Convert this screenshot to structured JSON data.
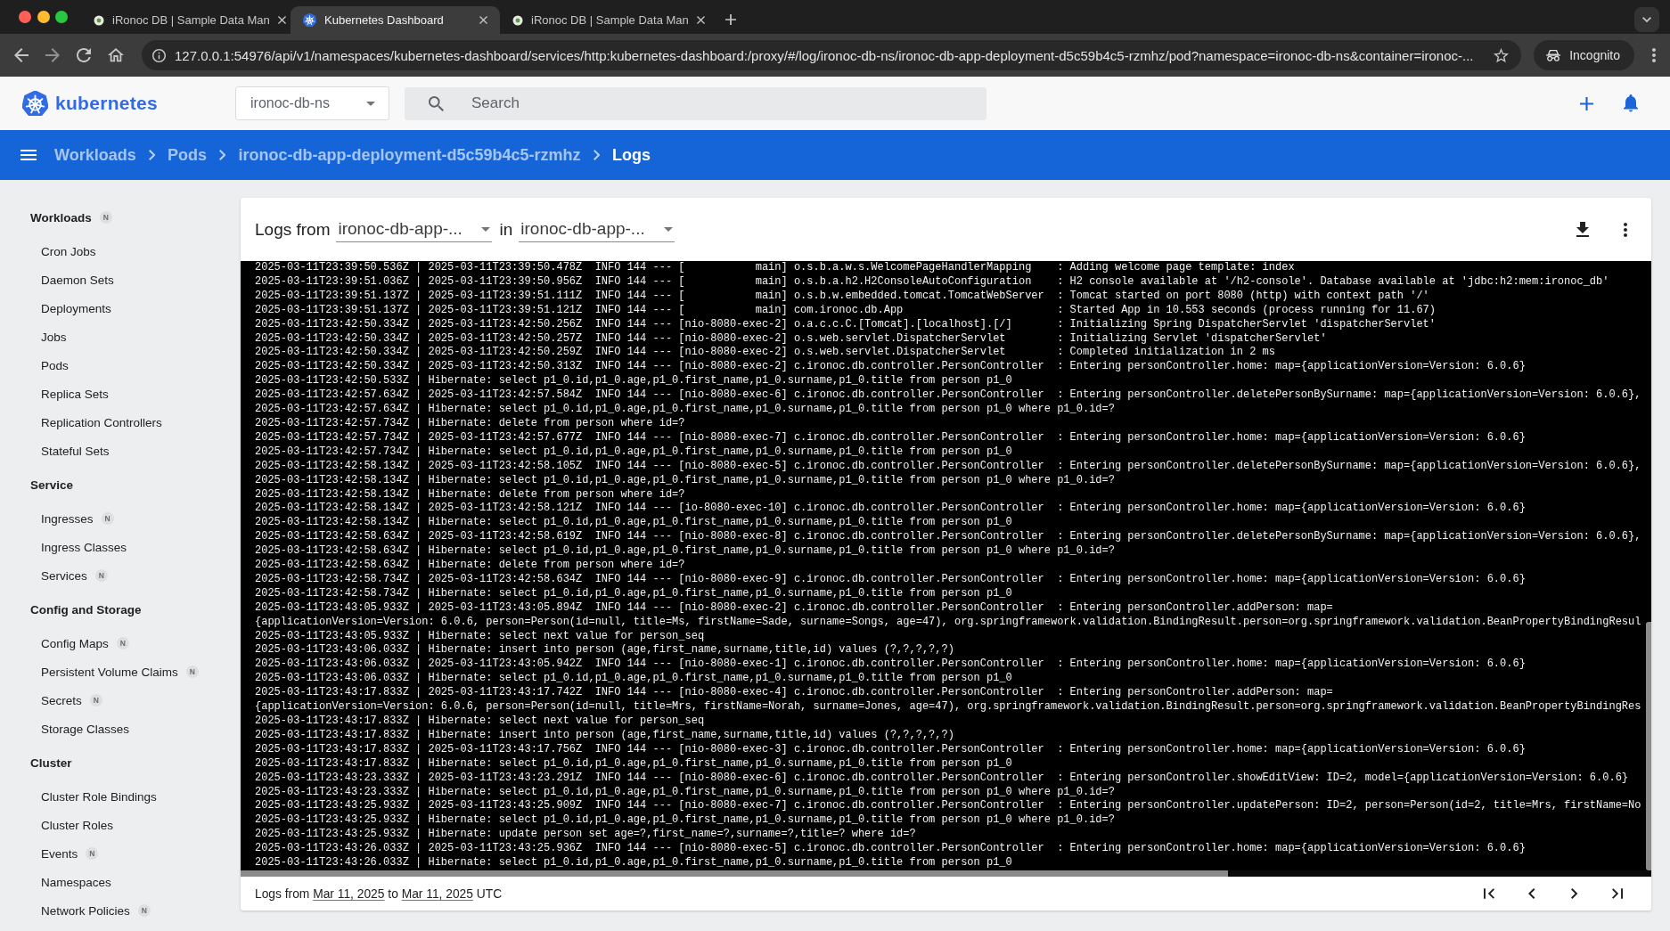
{
  "browser": {
    "tabs": [
      {
        "title": "iRonoc DB | Sample Data Man",
        "kind": "dot",
        "selected": false
      },
      {
        "title": "Kubernetes Dashboard",
        "kind": "wheel",
        "selected": true
      },
      {
        "title": "iRonoc DB | Sample Data Man",
        "kind": "dot",
        "selected": false
      }
    ],
    "url": "127.0.0.1:54976/api/v1/namespaces/kubernetes-dashboard/services/http:kubernetes-dashboard:/proxy/#/log/ironoc-db-ns/ironoc-db-app-deployment-d5c59b4c5-rzmhz/pod?namespace=ironoc-db-ns&container=ironoc-...",
    "profile": "Incognito"
  },
  "header": {
    "logo_text": "kubernetes",
    "namespace": "ironoc-db-ns",
    "search": {
      "placeholder": "Search"
    }
  },
  "breadcrumbs": [
    {
      "label": "Workloads",
      "current": false
    },
    {
      "label": "Pods",
      "current": false
    },
    {
      "label": "ironoc-db-app-deployment-d5c59b4c5-rzmhz",
      "current": false
    },
    {
      "label": "Logs",
      "current": true
    }
  ],
  "sidebar": {
    "sections": [
      {
        "title": "Workloads",
        "badge": "N",
        "items": [
          {
            "label": "Cron Jobs"
          },
          {
            "label": "Daemon Sets"
          },
          {
            "label": "Deployments"
          },
          {
            "label": "Jobs"
          },
          {
            "label": "Pods"
          },
          {
            "label": "Replica Sets"
          },
          {
            "label": "Replication Controllers"
          },
          {
            "label": "Stateful Sets"
          }
        ]
      },
      {
        "title": "Service",
        "items": [
          {
            "label": "Ingresses",
            "badge": "N"
          },
          {
            "label": "Ingress Classes"
          },
          {
            "label": "Services",
            "badge": "N"
          }
        ]
      },
      {
        "title": "Config and Storage",
        "items": [
          {
            "label": "Config Maps",
            "badge": "N"
          },
          {
            "label": "Persistent Volume Claims",
            "badge": "N"
          },
          {
            "label": "Secrets",
            "badge": "N"
          },
          {
            "label": "Storage Classes"
          }
        ]
      },
      {
        "title": "Cluster",
        "items": [
          {
            "label": "Cluster Role Bindings"
          },
          {
            "label": "Cluster Roles"
          },
          {
            "label": "Events",
            "badge": "N"
          },
          {
            "label": "Namespaces"
          },
          {
            "label": "Network Policies",
            "badge": "N"
          }
        ]
      }
    ]
  },
  "logs": {
    "title": "Logs from",
    "pod": "ironoc-db-app-...",
    "connector": "in",
    "container": "ironoc-db-app-...",
    "lines": [
      "2025-03-11T23:39:50.536Z | 2025-03-11T23:39:50.478Z  INFO 144 --- [           main] o.s.b.a.w.s.WelcomePageHandlerMapping    : Adding welcome page template: index",
      "2025-03-11T23:39:51.036Z | 2025-03-11T23:39:50.956Z  INFO 144 --- [           main] o.s.b.a.h2.H2ConsoleAutoConfiguration    : H2 console available at '/h2-console'. Database available at 'jdbc:h2:mem:ironoc_db'",
      "2025-03-11T23:39:51.137Z | 2025-03-11T23:39:51.111Z  INFO 144 --- [           main] o.s.b.w.embedded.tomcat.TomcatWebServer  : Tomcat started on port 8080 (http) with context path '/'",
      "2025-03-11T23:39:51.137Z | 2025-03-11T23:39:51.121Z  INFO 144 --- [           main] com.ironoc.db.App                        : Started App in 10.553 seconds (process running for 11.67)",
      "2025-03-11T23:42:50.334Z | 2025-03-11T23:42:50.256Z  INFO 144 --- [nio-8080-exec-2] o.a.c.c.C.[Tomcat].[localhost].[/]       : Initializing Spring DispatcherServlet 'dispatcherServlet'",
      "2025-03-11T23:42:50.334Z | 2025-03-11T23:42:50.257Z  INFO 144 --- [nio-8080-exec-2] o.s.web.servlet.DispatcherServlet        : Initializing Servlet 'dispatcherServlet'",
      "2025-03-11T23:42:50.334Z | 2025-03-11T23:42:50.259Z  INFO 144 --- [nio-8080-exec-2] o.s.web.servlet.DispatcherServlet        : Completed initialization in 2 ms",
      "2025-03-11T23:42:50.334Z | 2025-03-11T23:42:50.313Z  INFO 144 --- [nio-8080-exec-2] c.ironoc.db.controller.PersonController  : Entering personController.home: map={applicationVersion=Version: 6.0.6}",
      "2025-03-11T23:42:50.533Z | Hibernate: select p1_0.id,p1_0.age,p1_0.first_name,p1_0.surname,p1_0.title from person p1_0",
      "2025-03-11T23:42:57.634Z | 2025-03-11T23:42:57.584Z  INFO 144 --- [nio-8080-exec-6] c.ironoc.db.controller.PersonController  : Entering personController.deletePersonBySurname: map={applicationVersion=Version: 6.0.6},",
      "2025-03-11T23:42:57.634Z | Hibernate: select p1_0.id,p1_0.age,p1_0.first_name,p1_0.surname,p1_0.title from person p1_0 where p1_0.id=?",
      "2025-03-11T23:42:57.734Z | Hibernate: delete from person where id=?",
      "2025-03-11T23:42:57.734Z | 2025-03-11T23:42:57.677Z  INFO 144 --- [nio-8080-exec-7] c.ironoc.db.controller.PersonController  : Entering personController.home: map={applicationVersion=Version: 6.0.6}",
      "2025-03-11T23:42:57.734Z | Hibernate: select p1_0.id,p1_0.age,p1_0.first_name,p1_0.surname,p1_0.title from person p1_0",
      "2025-03-11T23:42:58.134Z | 2025-03-11T23:42:58.105Z  INFO 144 --- [nio-8080-exec-5] c.ironoc.db.controller.PersonController  : Entering personController.deletePersonBySurname: map={applicationVersion=Version: 6.0.6},",
      "2025-03-11T23:42:58.134Z | Hibernate: select p1_0.id,p1_0.age,p1_0.first_name,p1_0.surname,p1_0.title from person p1_0 where p1_0.id=?",
      "2025-03-11T23:42:58.134Z | Hibernate: delete from person where id=?",
      "2025-03-11T23:42:58.134Z | 2025-03-11T23:42:58.121Z  INFO 144 --- [io-8080-exec-10] c.ironoc.db.controller.PersonController  : Entering personController.home: map={applicationVersion=Version: 6.0.6}",
      "2025-03-11T23:42:58.134Z | Hibernate: select p1_0.id,p1_0.age,p1_0.first_name,p1_0.surname,p1_0.title from person p1_0",
      "2025-03-11T23:42:58.634Z | 2025-03-11T23:42:58.619Z  INFO 144 --- [nio-8080-exec-8] c.ironoc.db.controller.PersonController  : Entering personController.deletePersonBySurname: map={applicationVersion=Version: 6.0.6},",
      "2025-03-11T23:42:58.634Z | Hibernate: select p1_0.id,p1_0.age,p1_0.first_name,p1_0.surname,p1_0.title from person p1_0 where p1_0.id=?",
      "2025-03-11T23:42:58.634Z | Hibernate: delete from person where id=?",
      "2025-03-11T23:42:58.734Z | 2025-03-11T23:42:58.634Z  INFO 144 --- [nio-8080-exec-9] c.ironoc.db.controller.PersonController  : Entering personController.home: map={applicationVersion=Version: 6.0.6}",
      "2025-03-11T23:42:58.734Z | Hibernate: select p1_0.id,p1_0.age,p1_0.first_name,p1_0.surname,p1_0.title from person p1_0",
      "2025-03-11T23:43:05.933Z | 2025-03-11T23:43:05.894Z  INFO 144 --- [nio-8080-exec-2] c.ironoc.db.controller.PersonController  : Entering personController.addPerson: map=",
      "{applicationVersion=Version: 6.0.6, person=Person(id=null, title=Ms, firstName=Sade, surname=Songs, age=47), org.springframework.validation.BindingResult.person=org.springframework.validation.BeanPropertyBindingResul",
      "2025-03-11T23:43:05.933Z | Hibernate: select next value for person_seq",
      "2025-03-11T23:43:06.033Z | Hibernate: insert into person (age,first_name,surname,title,id) values (?,?,?,?,?)",
      "2025-03-11T23:43:06.033Z | 2025-03-11T23:43:05.942Z  INFO 144 --- [nio-8080-exec-1] c.ironoc.db.controller.PersonController  : Entering personController.home: map={applicationVersion=Version: 6.0.6}",
      "2025-03-11T23:43:06.033Z | Hibernate: select p1_0.id,p1_0.age,p1_0.first_name,p1_0.surname,p1_0.title from person p1_0",
      "2025-03-11T23:43:17.833Z | 2025-03-11T23:43:17.742Z  INFO 144 --- [nio-8080-exec-4] c.ironoc.db.controller.PersonController  : Entering personController.addPerson: map=",
      "{applicationVersion=Version: 6.0.6, person=Person(id=null, title=Mrs, firstName=Norah, surname=Jones, age=47), org.springframework.validation.BindingResult.person=org.springframework.validation.BeanPropertyBindingRes",
      "2025-03-11T23:43:17.833Z | Hibernate: select next value for person_seq",
      "2025-03-11T23:43:17.833Z | Hibernate: insert into person (age,first_name,surname,title,id) values (?,?,?,?,?)",
      "2025-03-11T23:43:17.833Z | 2025-03-11T23:43:17.756Z  INFO 144 --- [nio-8080-exec-3] c.ironoc.db.controller.PersonController  : Entering personController.home: map={applicationVersion=Version: 6.0.6}",
      "2025-03-11T23:43:17.833Z | Hibernate: select p1_0.id,p1_0.age,p1_0.first_name,p1_0.surname,p1_0.title from person p1_0",
      "2025-03-11T23:43:23.333Z | 2025-03-11T23:43:23.291Z  INFO 144 --- [nio-8080-exec-6] c.ironoc.db.controller.PersonController  : Entering personController.showEditView: ID=2, model={applicationVersion=Version: 6.0.6}",
      "2025-03-11T23:43:23.333Z | Hibernate: select p1_0.id,p1_0.age,p1_0.first_name,p1_0.surname,p1_0.title from person p1_0 where p1_0.id=?",
      "2025-03-11T23:43:25.933Z | 2025-03-11T23:43:25.909Z  INFO 144 --- [nio-8080-exec-7] c.ironoc.db.controller.PersonController  : Entering personController.updatePerson: ID=2, person=Person(id=2, title=Mrs, firstName=No",
      "2025-03-11T23:43:25.933Z | Hibernate: select p1_0.id,p1_0.age,p1_0.first_name,p1_0.surname,p1_0.title from person p1_0 where p1_0.id=?",
      "2025-03-11T23:43:25.933Z | Hibernate: update person set age=?,first_name=?,surname=?,title=? where id=?",
      "2025-03-11T23:43:26.033Z | 2025-03-11T23:43:25.936Z  INFO 144 --- [nio-8080-exec-5] c.ironoc.db.controller.PersonController  : Entering personController.home: map={applicationVersion=Version: 6.0.6}",
      "2025-03-11T23:43:26.033Z | Hibernate: select p1_0.id,p1_0.age,p1_0.first_name,p1_0.surname,p1_0.title from person p1_0"
    ],
    "footer": {
      "prefix": "Logs from",
      "start": "Mar 11, 2025",
      "middle": "to",
      "end": "Mar 11, 2025",
      "suffix": "UTC"
    }
  }
}
